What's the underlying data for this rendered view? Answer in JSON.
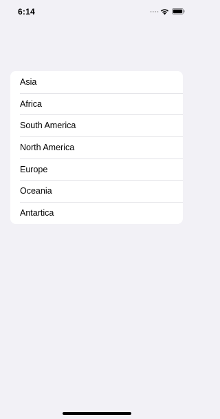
{
  "status_bar": {
    "time": "6:14",
    "icons": [
      "signal-icon",
      "wifi-icon",
      "battery-icon"
    ]
  },
  "regions": {
    "items": [
      {
        "label": "Asia"
      },
      {
        "label": "Africa"
      },
      {
        "label": "South America"
      },
      {
        "label": "North America"
      },
      {
        "label": "Europe"
      },
      {
        "label": "Oceania"
      },
      {
        "label": "Antartica"
      }
    ]
  },
  "colors": {
    "background": "#f2f1f6",
    "card": "#ffffff",
    "separator": "#e3e3e7",
    "text": "#000000"
  }
}
